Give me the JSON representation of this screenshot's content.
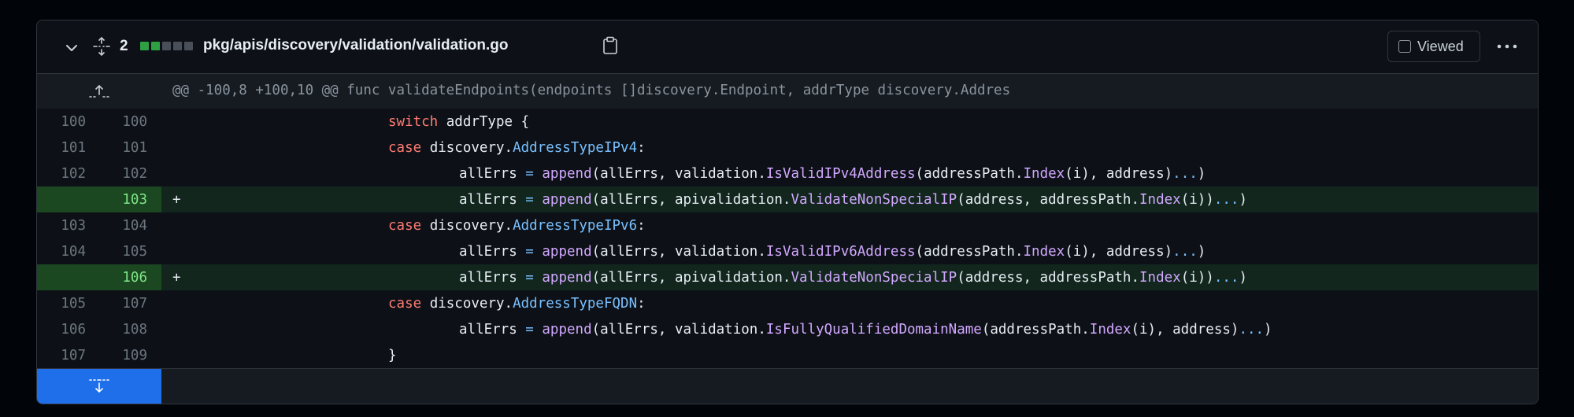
{
  "file": {
    "changes_count": "2",
    "path": "pkg/apis/discovery/validation/validation.go",
    "viewed_label": "Viewed",
    "colors": {
      "added": "#2ea043",
      "neutral": "#484f58"
    },
    "diffstat": [
      "added",
      "added",
      "neutral",
      "neutral",
      "neutral"
    ]
  },
  "hunk": {
    "header": "@@ -100,8 +100,10 @@ func validateEndpoints(endpoints []discovery.Endpoint, addrType discovery.Addres"
  },
  "lines": [
    {
      "old": "100",
      "new": "100",
      "type": "ctx",
      "indent": "      ",
      "tokens": [
        [
          "kw",
          "switch"
        ],
        [
          "",
          " addrType {"
        ]
      ]
    },
    {
      "old": "101",
      "new": "101",
      "type": "ctx",
      "indent": "      ",
      "tokens": [
        [
          "kw",
          "case"
        ],
        [
          "",
          " discovery."
        ],
        [
          "ty",
          "AddressTypeIPv4"
        ],
        [
          "",
          ":"
        ]
      ]
    },
    {
      "old": "102",
      "new": "102",
      "type": "ctx",
      "indent": "        ",
      "tokens": [
        [
          "",
          "allErrs "
        ],
        [
          "op",
          "="
        ],
        [
          "",
          " "
        ],
        [
          "fn",
          "append"
        ],
        [
          "",
          "(allErrs, validation."
        ],
        [
          "fn",
          "IsValidIPv4Address"
        ],
        [
          "",
          "(addressPath."
        ],
        [
          "fn",
          "Index"
        ],
        [
          "",
          "(i), address)"
        ],
        [
          "op",
          "..."
        ],
        [
          "",
          ")"
        ]
      ]
    },
    {
      "old": "",
      "new": "103",
      "type": "add",
      "indent": "        ",
      "tokens": [
        [
          "",
          "allErrs "
        ],
        [
          "op",
          "="
        ],
        [
          "",
          " "
        ],
        [
          "fn",
          "append"
        ],
        [
          "",
          "(allErrs, apivalidation."
        ],
        [
          "fn",
          "ValidateNonSpecialIP"
        ],
        [
          "",
          "(address, addressPath."
        ],
        [
          "fn",
          "Index"
        ],
        [
          "",
          "(i))"
        ],
        [
          "op",
          "..."
        ],
        [
          "",
          ")"
        ]
      ]
    },
    {
      "old": "103",
      "new": "104",
      "type": "ctx",
      "indent": "      ",
      "tokens": [
        [
          "kw",
          "case"
        ],
        [
          "",
          " discovery."
        ],
        [
          "ty",
          "AddressTypeIPv6"
        ],
        [
          "",
          ":"
        ]
      ]
    },
    {
      "old": "104",
      "new": "105",
      "type": "ctx",
      "indent": "        ",
      "tokens": [
        [
          "",
          "allErrs "
        ],
        [
          "op",
          "="
        ],
        [
          "",
          " "
        ],
        [
          "fn",
          "append"
        ],
        [
          "",
          "(allErrs, validation."
        ],
        [
          "fn",
          "IsValidIPv6Address"
        ],
        [
          "",
          "(addressPath."
        ],
        [
          "fn",
          "Index"
        ],
        [
          "",
          "(i), address)"
        ],
        [
          "op",
          "..."
        ],
        [
          "",
          ")"
        ]
      ]
    },
    {
      "old": "",
      "new": "106",
      "type": "add",
      "indent": "        ",
      "tokens": [
        [
          "",
          "allErrs "
        ],
        [
          "op",
          "="
        ],
        [
          "",
          " "
        ],
        [
          "fn",
          "append"
        ],
        [
          "",
          "(allErrs, apivalidation."
        ],
        [
          "fn",
          "ValidateNonSpecialIP"
        ],
        [
          "",
          "(address, addressPath."
        ],
        [
          "fn",
          "Index"
        ],
        [
          "",
          "(i))"
        ],
        [
          "op",
          "..."
        ],
        [
          "",
          ")"
        ]
      ]
    },
    {
      "old": "105",
      "new": "107",
      "type": "ctx",
      "indent": "      ",
      "tokens": [
        [
          "kw",
          "case"
        ],
        [
          "",
          " discovery."
        ],
        [
          "ty",
          "AddressTypeFQDN"
        ],
        [
          "",
          ":"
        ]
      ]
    },
    {
      "old": "106",
      "new": "108",
      "type": "ctx",
      "indent": "        ",
      "tokens": [
        [
          "",
          "allErrs "
        ],
        [
          "op",
          "="
        ],
        [
          "",
          " "
        ],
        [
          "fn",
          "append"
        ],
        [
          "",
          "(allErrs, validation."
        ],
        [
          "fn",
          "IsFullyQualifiedDomainName"
        ],
        [
          "",
          "(addressPath."
        ],
        [
          "fn",
          "Index"
        ],
        [
          "",
          "(i), address)"
        ],
        [
          "op",
          "..."
        ],
        [
          "",
          ")"
        ]
      ]
    },
    {
      "old": "107",
      "new": "109",
      "type": "ctx",
      "indent": "      ",
      "tokens": [
        [
          "",
          "}"
        ]
      ]
    }
  ]
}
